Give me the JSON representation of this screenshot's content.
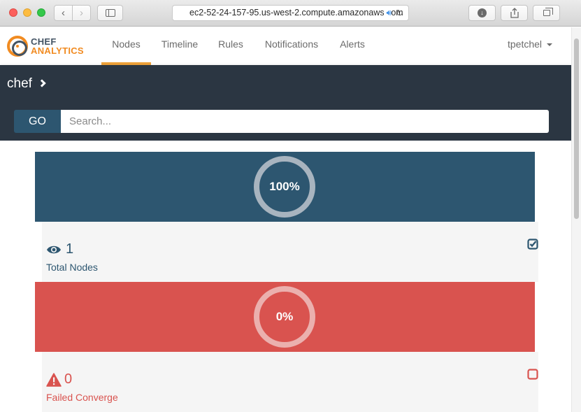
{
  "browser": {
    "url": "ec2-52-24-157-95.us-west-2.compute.amazonaws.com"
  },
  "app": {
    "logo": {
      "line1": "CHEF",
      "line2": "ANALYTICS"
    },
    "nav": [
      {
        "label": "Nodes",
        "active": true
      },
      {
        "label": "Timeline",
        "active": false
      },
      {
        "label": "Rules",
        "active": false
      },
      {
        "label": "Notifications",
        "active": false
      },
      {
        "label": "Alerts",
        "active": false
      }
    ],
    "user": "tpetchel",
    "colors": {
      "accent": "#f0a33a",
      "primary": "#2d5670",
      "danger": "#d9534f",
      "header": "#2b3642"
    }
  },
  "toolbar": {
    "breadcrumb": "chef",
    "go_label": "GO",
    "search_placeholder": "Search..."
  },
  "cards": [
    {
      "percent": "100%",
      "count": "1",
      "label": "Total Nodes",
      "icon": "eye-icon",
      "checked": true
    },
    {
      "percent": "0%",
      "count": "0",
      "label": "Failed Converge",
      "icon": "warning-icon",
      "checked": false
    }
  ]
}
